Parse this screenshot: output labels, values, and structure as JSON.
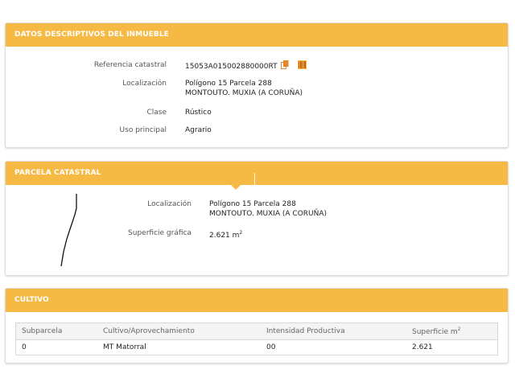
{
  "datos": {
    "title": "DATOS DESCRIPTIVOS DEL INMUEBLE",
    "referencia_label": "Referencia catastral",
    "referencia_value": "15053A015002880000RT",
    "localizacion_label": "Localización",
    "localizacion_line1": "Polígono 15 Parcela 288",
    "localizacion_line2": "MONTOUTO. MUXIA (A CORUÑA)",
    "clase_label": "Clase",
    "clase_value": "Rústico",
    "uso_label": "Uso principal",
    "uso_value": "Agrario",
    "icons": [
      "copy-icon",
      "barcode-icon"
    ]
  },
  "parcela": {
    "title": "PARCELA CATASTRAL",
    "localizacion_label": "Localización",
    "localizacion_line1": "Polígono 15 Parcela 288",
    "localizacion_line2": "MONTOUTO. MUXIA (A CORUÑA)",
    "superficie_label": "Superficie gráfica",
    "superficie_value": "2.621 m",
    "superficie_exp": "2"
  },
  "cultivo": {
    "title": "CULTIVO",
    "headers": [
      "Subparcela",
      "Cultivo/Aprovechamiento",
      "Intensidad Productiva",
      "Superficie m"
    ],
    "header_exp": "2",
    "rows": [
      [
        "0",
        "MT Matorral",
        "00",
        "2.621"
      ]
    ]
  },
  "colors": {
    "accent": "#f6b944",
    "icon_orange": "#e8872a"
  }
}
